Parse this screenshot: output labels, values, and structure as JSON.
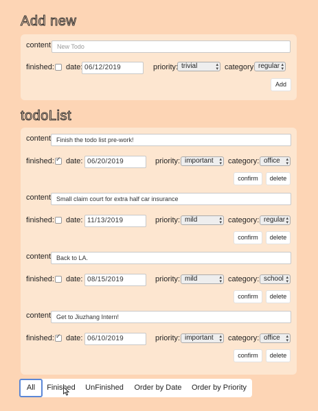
{
  "add_section": {
    "title": "Add new",
    "content_label": "content:",
    "content_placeholder": "New Todo",
    "finished_label": "finished:",
    "date_label": "date:",
    "date_value": "06/12/2019",
    "priority_label": "priority:",
    "priority_value": "trivial",
    "category_label": "category:",
    "category_value": "regular",
    "add_button": "Add"
  },
  "list_section": {
    "title": "todoList",
    "labels": {
      "content": "content:",
      "finished": "finished:",
      "date": "date:",
      "priority": "priority:",
      "category": "category:",
      "confirm": "confirm",
      "delete": "delete"
    },
    "items": [
      {
        "content": "Finish the todo list pre-work!",
        "finished": true,
        "date": "06/20/2019",
        "priority": "important",
        "category": "office"
      },
      {
        "content": "Small claim court for extra half car insurance",
        "finished": false,
        "date": "11/13/2019",
        "priority": "mild",
        "category": "regular"
      },
      {
        "content": "Back to LA.",
        "finished": false,
        "date": "08/15/2019",
        "priority": "mild",
        "category": "school"
      },
      {
        "content": "Get to Jiuzhang Intern!",
        "finished": true,
        "date": "06/10/2019",
        "priority": "important",
        "category": "office"
      }
    ]
  },
  "filter_tabs": [
    "All",
    "Finished",
    "UnFinished",
    "Order by Date",
    "Order by Priority"
  ],
  "active_tab": "All"
}
